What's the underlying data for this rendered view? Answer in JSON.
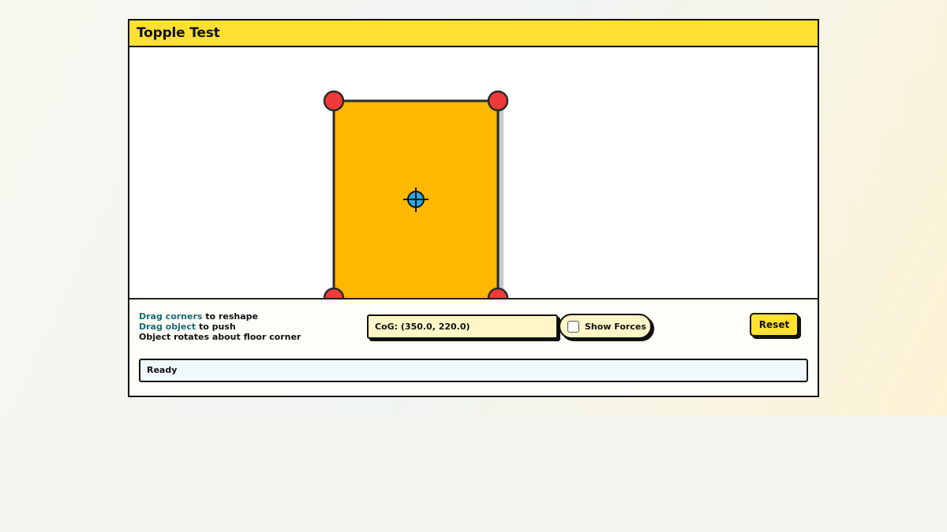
{
  "app": {
    "title": "Topple Test"
  },
  "instructions": {
    "line1_keyword": "Drag corners",
    "line1_rest": " to reshape",
    "line2_keyword": "Drag object",
    "line2_rest": " to push",
    "line3": "Object rotates about floor corner"
  },
  "cog": {
    "label": "CoG: (350.0, 220.0)"
  },
  "toggle": {
    "label": "Show Forces",
    "checked": false
  },
  "reset": {
    "label": "Reset"
  },
  "status": {
    "text": "Ready"
  },
  "colors": {
    "title_bar": "#ffe033",
    "object_fill": "#ffb800",
    "corner_handle": "#f03a3a",
    "cog_marker": "#29a8e0",
    "keyword_text": "#1a6b76"
  },
  "icons": {
    "corner_handle": "corner-handle-icon",
    "cog_marker": "crosshair-icon",
    "checkbox": "checkbox-icon"
  }
}
